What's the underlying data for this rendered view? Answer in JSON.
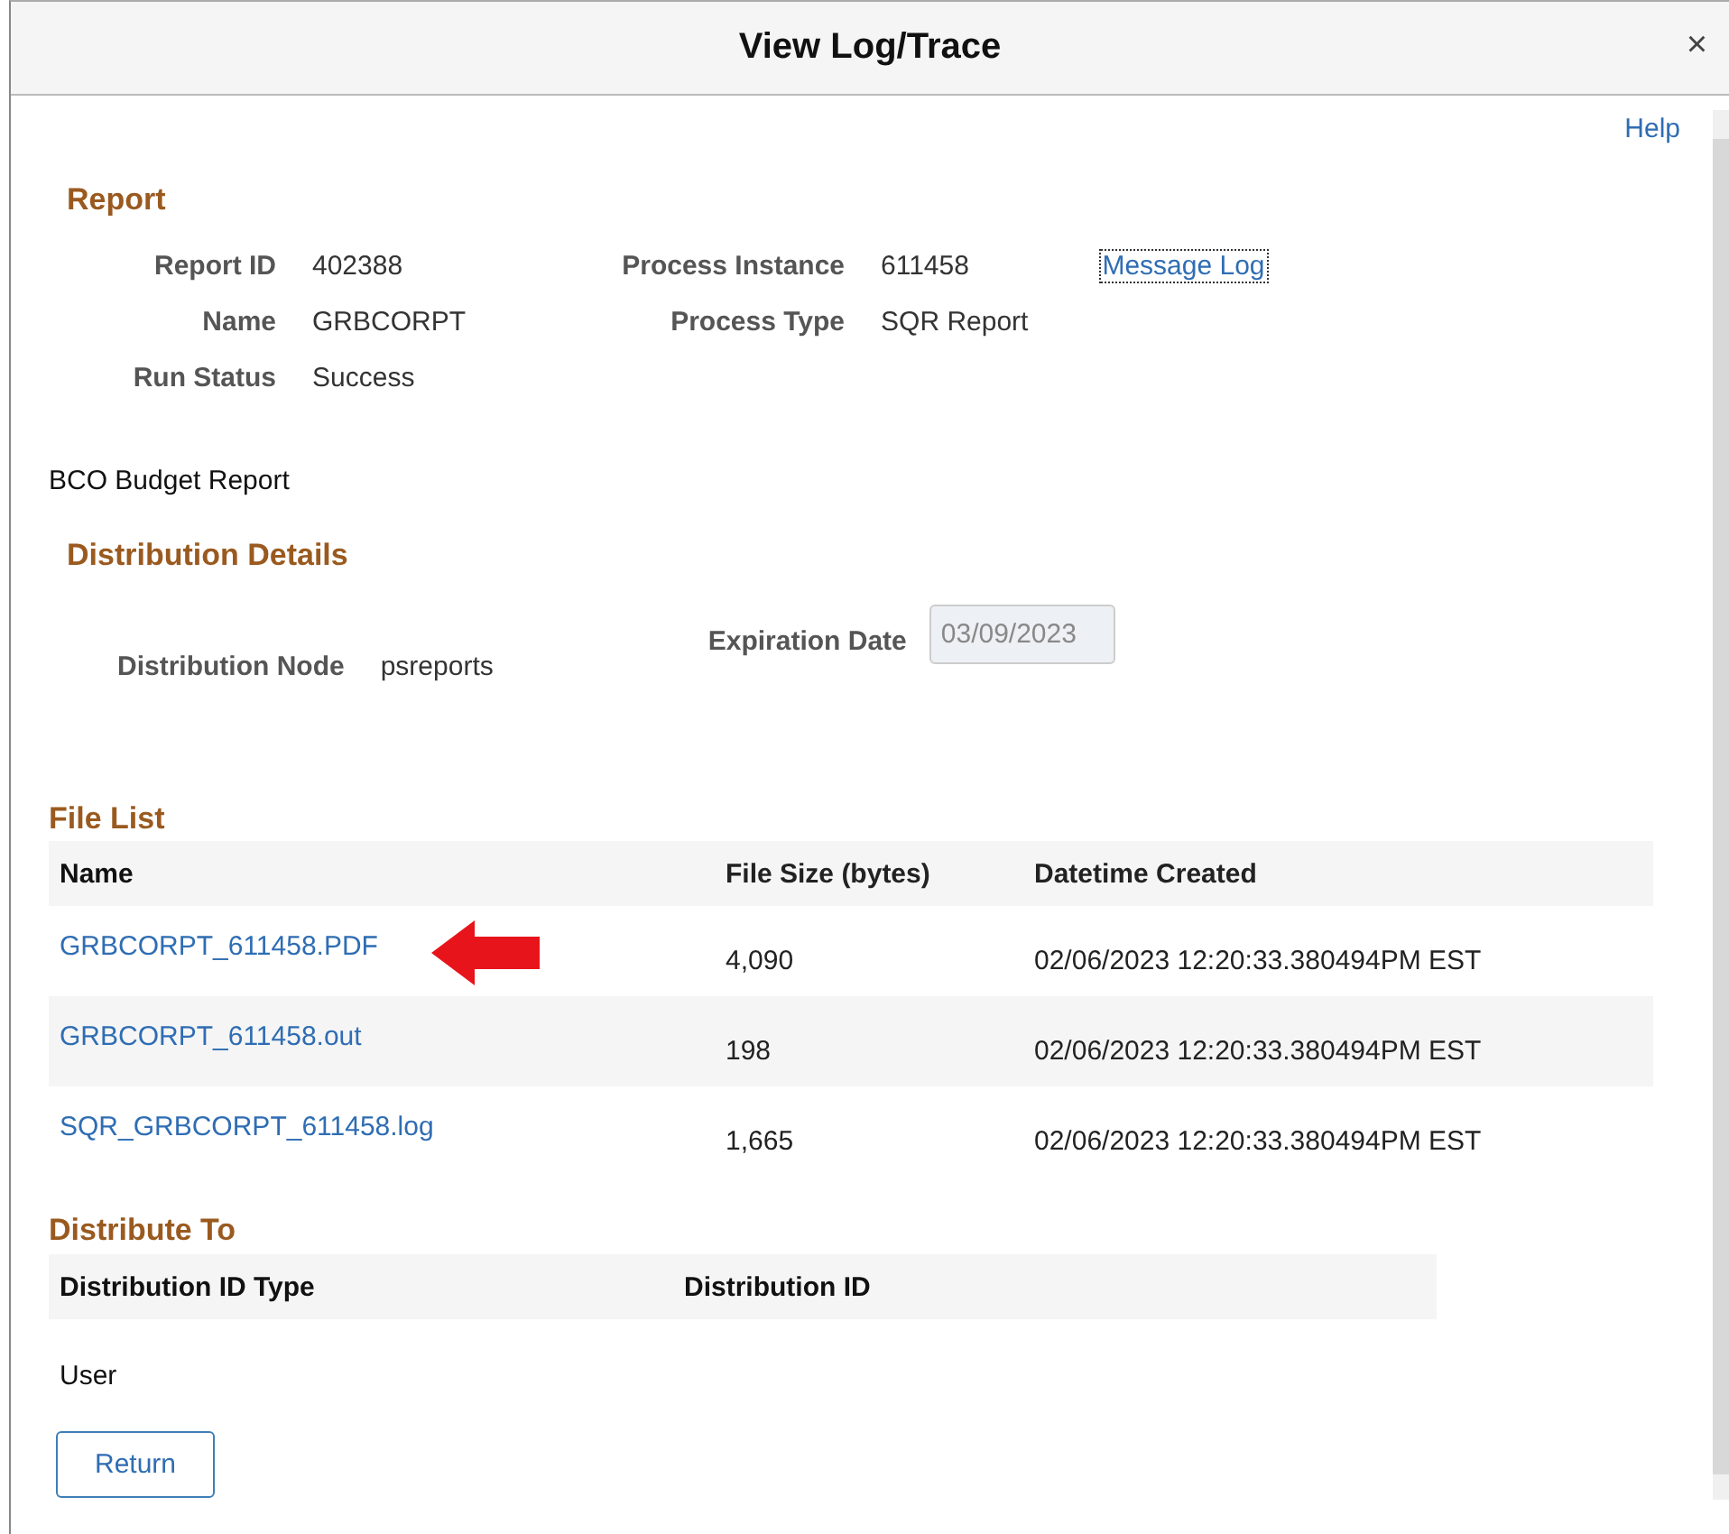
{
  "window": {
    "title": "View Log/Trace",
    "close_icon": "×"
  },
  "help_link": "Help",
  "report": {
    "heading": "Report",
    "left_fields": [
      {
        "label": "Report ID",
        "value": "402388"
      },
      {
        "label": "Name",
        "value": "GRBCORPT"
      },
      {
        "label": "Run Status",
        "value": "Success"
      }
    ],
    "right_fields": [
      {
        "label": "Process Instance",
        "value": "611458"
      },
      {
        "label": "Process Type",
        "value": "SQR Report"
      }
    ],
    "message_log": {
      "label": "Message Log",
      "focused": true
    }
  },
  "description": "BCO Budget Report",
  "distribution_details": {
    "heading": "Distribution Details",
    "node": {
      "label": "Distribution Node",
      "value": "psreports"
    },
    "expiration_date": {
      "label": "Expiration Date",
      "value": "03/09/2023",
      "disabled": true
    }
  },
  "file_list": {
    "heading": "File List",
    "columns": [
      "Name",
      "File Size (bytes)",
      "Datetime Created"
    ],
    "rows": [
      {
        "name": "GRBCORPT_611458.PDF",
        "size": "4,090",
        "created": "02/06/2023 12:20:33.380494PM EST",
        "annotated": true
      },
      {
        "name": "GRBCORPT_611458.out",
        "size": "198",
        "created": "02/06/2023 12:20:33.380494PM EST",
        "annotated": false
      },
      {
        "name": "SQR_GRBCORPT_611458.log",
        "size": "1,665",
        "created": "02/06/2023 12:20:33.380494PM EST",
        "annotated": false
      }
    ]
  },
  "distribute_to": {
    "heading": "Distribute To",
    "columns": [
      "Distribution ID Type",
      "Distribution ID"
    ],
    "rows": [
      {
        "id_type": "User"
      }
    ]
  },
  "return_button": "Return"
}
